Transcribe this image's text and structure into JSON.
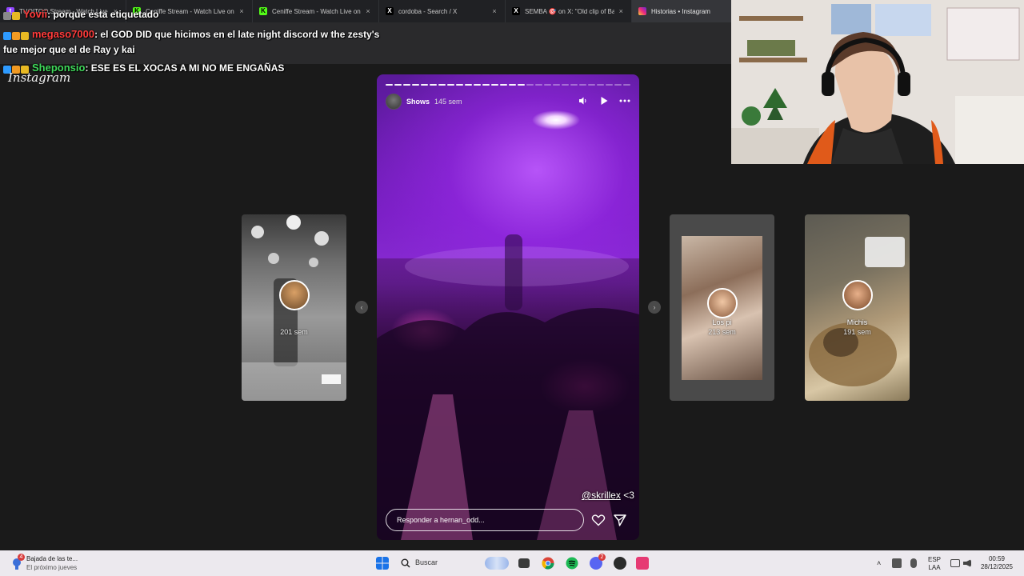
{
  "browser": {
    "tabs": [
      {
        "title": "TUQITOO Stream - Watch Live on",
        "active": false
      },
      {
        "title": "Ceniffe Stream - Watch Live on",
        "active": false
      },
      {
        "title": "Ceniffe Stream - Watch Live on",
        "active": false
      },
      {
        "title": "cordoba - Search / X",
        "active": false
      },
      {
        "title": "SEMBA 🎯 on X: \"Old clip of Ban",
        "active": false
      },
      {
        "title": "Historias • Instagram",
        "active": true
      }
    ],
    "close_glyph": "×"
  },
  "chat": {
    "lines": [
      {
        "user": "Yovii",
        "user_color": "#ff3b3b",
        "message": ": porque esta etiquetado"
      },
      {
        "user": "megaso7000",
        "user_color": "#ff3b3b",
        "message": ": el GOD DID que hicimos en el late night discord w the zesty's"
      },
      {
        "user": "",
        "user_color": "#ffffff",
        "message": "fue mejor que el de Ray y kai"
      },
      {
        "user": "Sheponsio",
        "user_color": "#3fd85a",
        "message": ": ESE ES EL XOCAS A MI NO ME ENGAÑAS"
      }
    ]
  },
  "instagram": {
    "logo": "Instagram",
    "story": {
      "username": "Shows",
      "time": "145 sem",
      "progress_total": 28,
      "progress_done": 16,
      "mention_user": "@skrillex",
      "mention_suffix": " <3",
      "reply_placeholder": "Responder a hernan_odd..."
    },
    "side_stories": [
      {
        "label": "",
        "time": "201 sem"
      },
      {
        "label": "Los pi",
        "time": "213 sem"
      },
      {
        "label": "Michis",
        "time": "191 sem"
      }
    ],
    "prev_glyph": "‹",
    "next_glyph": "›"
  },
  "taskbar": {
    "weather_title": "Bajada de las te...",
    "weather_sub": "El próximo jueves",
    "weather_badge": "4",
    "search_label": "Buscar",
    "lang_top": "ESP",
    "lang_bottom": "LAA",
    "time": "00:59",
    "date": "28/12/2025",
    "discord_badge": "2"
  },
  "colors": {
    "accent_purple": "#8b2ed6",
    "taskbar_bg": "#ece9ee",
    "page_bg": "#1a1a1a"
  }
}
